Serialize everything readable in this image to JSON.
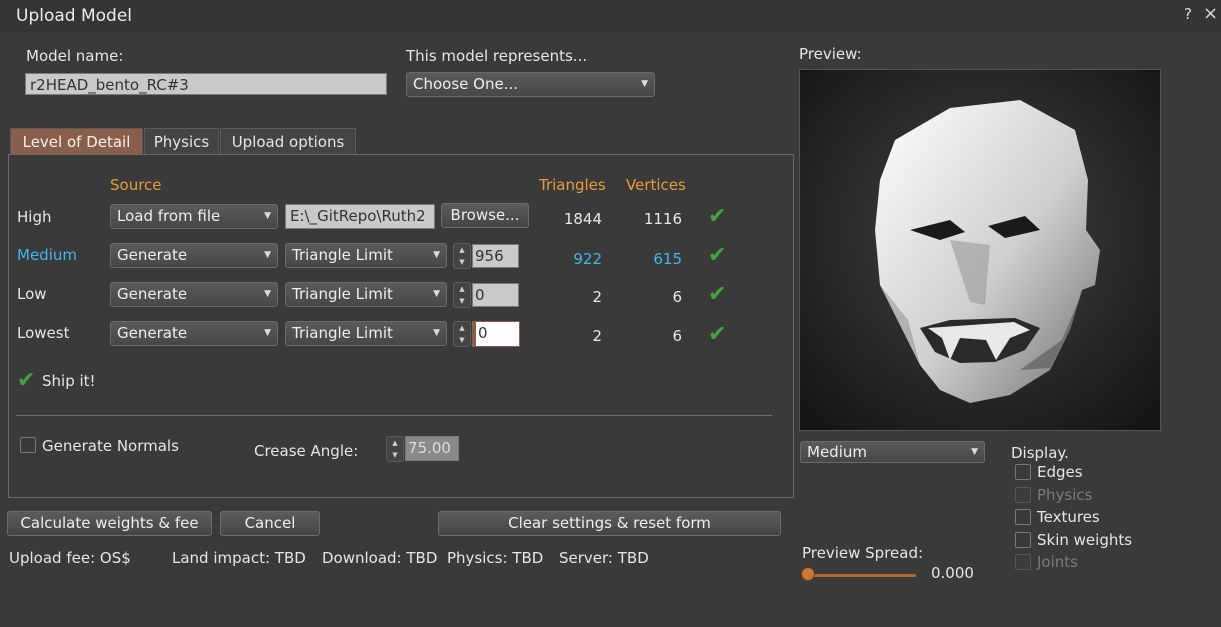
{
  "window": {
    "title": "Upload Model",
    "help_icon": "?",
    "close_icon": "×"
  },
  "model_name": {
    "label": "Model name:",
    "value": "r2HEAD_bento_RC#3"
  },
  "represents": {
    "label": "This model represents...",
    "value": "Choose One..."
  },
  "tabs": [
    {
      "label": "Level of Detail",
      "active": true
    },
    {
      "label": "Physics",
      "active": false
    },
    {
      "label": "Upload options",
      "active": false
    }
  ],
  "lod": {
    "headers": {
      "source": "Source",
      "triangles": "Triangles",
      "vertices": "Vertices"
    },
    "rows": [
      {
        "name": "High",
        "source": "Load from file",
        "file": "E:\\_GitRepo\\Ruth2",
        "browse": "Browse...",
        "triangles": "1844",
        "vertices": "1116"
      },
      {
        "name": "Medium",
        "source": "Generate",
        "mode": "Triangle Limit",
        "limit": "956",
        "triangles": "922",
        "vertices": "615"
      },
      {
        "name": "Low",
        "source": "Generate",
        "mode": "Triangle Limit",
        "limit": "0",
        "triangles": "2",
        "vertices": "6"
      },
      {
        "name": "Lowest",
        "source": "Generate",
        "mode": "Triangle Limit",
        "limit": "0",
        "triangles": "2",
        "vertices": "6"
      }
    ],
    "ship_it": "Ship it!",
    "generate_normals": "Generate Normals",
    "crease_angle_label": "Crease Angle:",
    "crease_angle_value": "75.00"
  },
  "buttons": {
    "calculate": "Calculate weights & fee",
    "cancel": "Cancel",
    "clear": "Clear settings & reset form"
  },
  "status": {
    "upload_fee": "Upload fee: OS$",
    "land_impact": "Land impact: TBD",
    "download": "Download: TBD",
    "physics": "Physics: TBD",
    "server": "Server: TBD"
  },
  "preview": {
    "label": "Preview:",
    "lod_select": "Medium",
    "display_label": "Display.",
    "options": [
      {
        "label": "Edges",
        "enabled": true
      },
      {
        "label": "Physics",
        "enabled": false
      },
      {
        "label": "Textures",
        "enabled": true
      },
      {
        "label": "Skin weights",
        "enabled": true
      },
      {
        "label": "Joints",
        "enabled": false
      }
    ],
    "spread_label": "Preview Spread:",
    "spread_value": "0.000"
  },
  "colors": {
    "accent_orange": "#e89a3c",
    "accent_blue": "#3fb7ea",
    "tab_active": "#8a5e4a",
    "check_green": "#3fa63f"
  }
}
